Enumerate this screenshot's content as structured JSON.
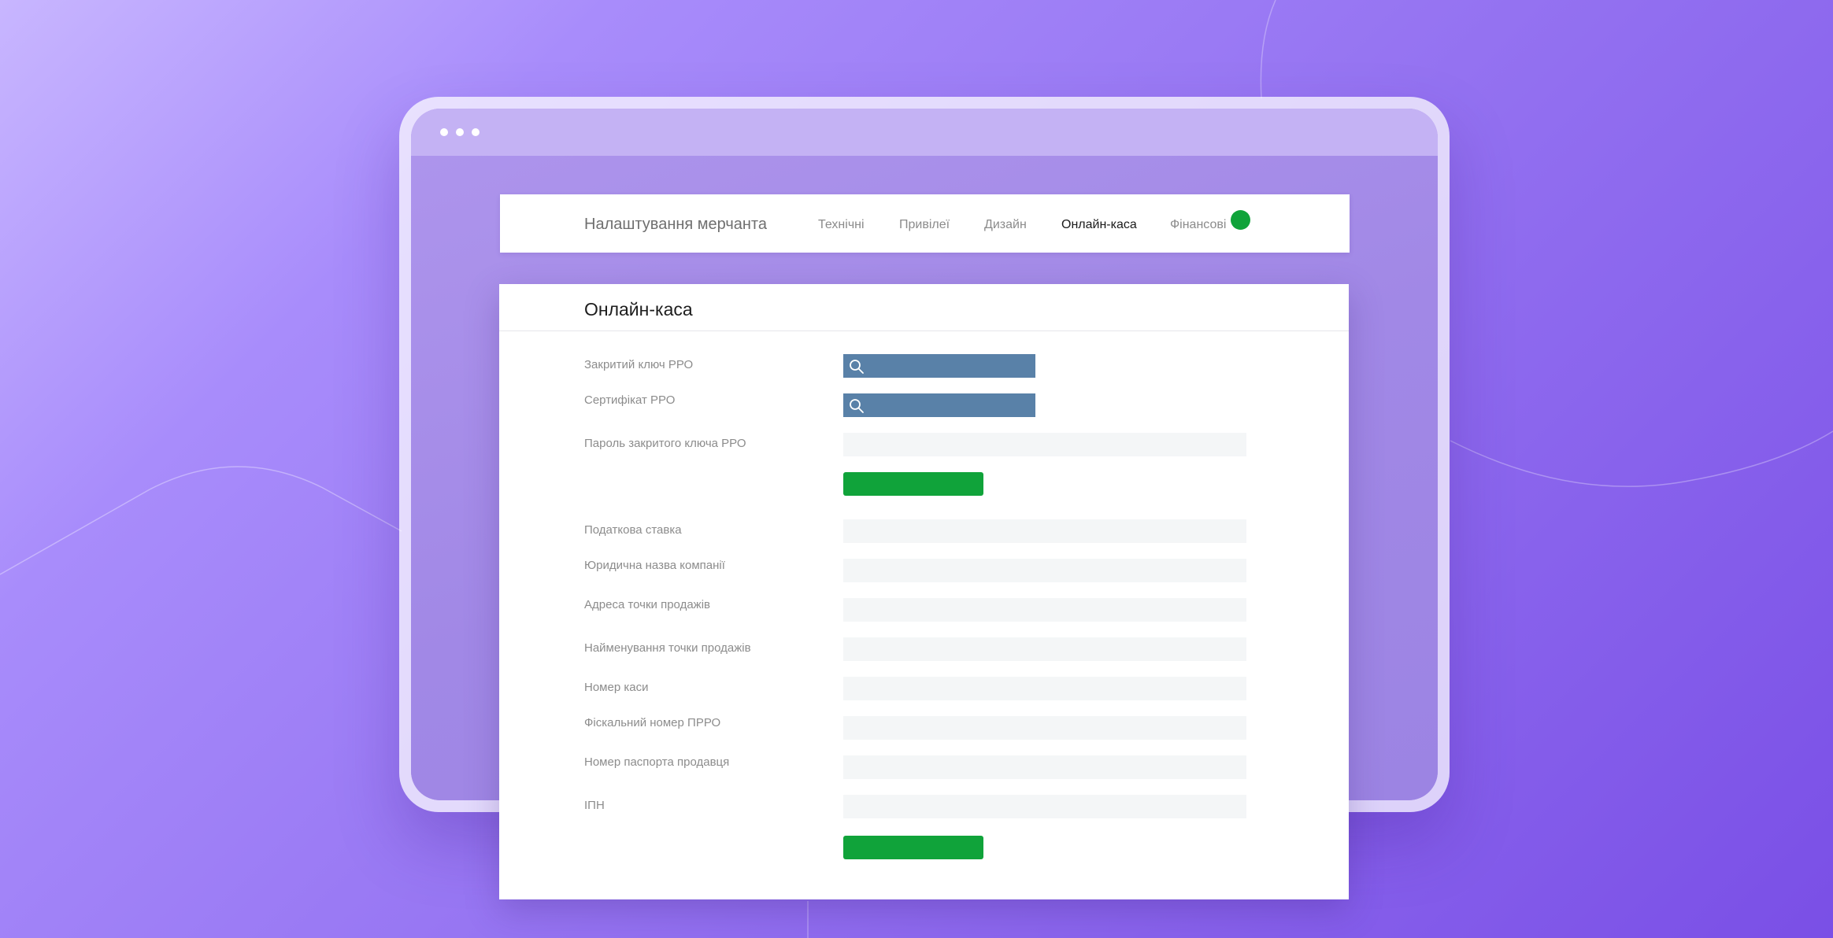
{
  "header": {
    "title": "Налаштування мерчанта",
    "tabs": [
      "Технічні",
      "Привілеї",
      "Дизайн",
      "Онлайн-каса",
      "Фінансові"
    ],
    "active_tab": "Онлайн-каса",
    "status_dot_color": "#10a33a"
  },
  "section": {
    "title": "Онлайн-каса",
    "fields": [
      {
        "label": "Закритий ключ РРО",
        "type": "file",
        "icon": "search-icon",
        "value": ""
      },
      {
        "label": "Сертифікат РРО",
        "type": "file",
        "icon": "search-icon",
        "value": ""
      },
      {
        "label": "Пароль закритого ключа РРО",
        "type": "text",
        "value": ""
      },
      {
        "label": "Податкова ставка",
        "type": "text",
        "value": ""
      },
      {
        "label": "Юридична назва компанії",
        "type": "text",
        "value": ""
      },
      {
        "label": "Адреса точки продажів",
        "type": "text",
        "value": ""
      },
      {
        "label": "Найменування точки продажів",
        "type": "text",
        "value": ""
      },
      {
        "label": "Номер каси",
        "type": "text",
        "value": ""
      },
      {
        "label": "Фіскальний номер ПРРО",
        "type": "text",
        "value": ""
      },
      {
        "label": "Номер паспорта продавця",
        "type": "text",
        "value": ""
      },
      {
        "label": "ІПН",
        "type": "text",
        "value": ""
      }
    ],
    "button_color": "#10a33a",
    "file_input_color": "#5981a8"
  }
}
